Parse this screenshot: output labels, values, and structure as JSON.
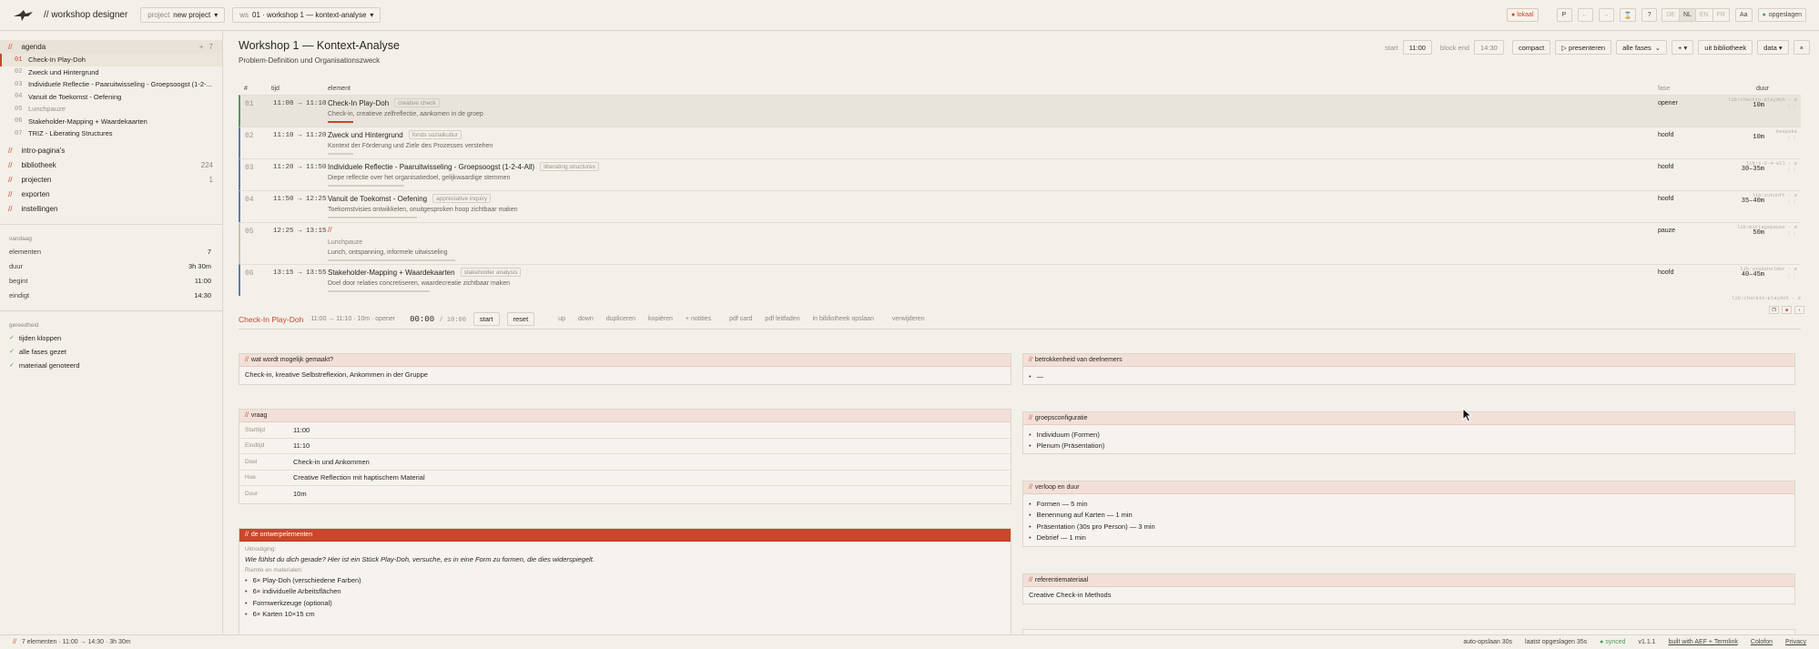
{
  "topbar": {
    "brand": "// workshop designer",
    "project_label": "project",
    "project_value": "new project",
    "ws_label": "ws",
    "ws_value": "01 · workshop 1 — kontext-analyse",
    "local_badge": "lokaal",
    "p_btn": "P",
    "undo": "←",
    "redo": "→",
    "timer_icon": "⌛",
    "help": "?",
    "langs": [
      "DE",
      "NL",
      "EN",
      "FR"
    ],
    "font_btn": "Aa",
    "saved": "opgeslagen"
  },
  "sidebar": {
    "agenda_label": "agenda",
    "agenda_count": "7",
    "items": [
      {
        "n": "01",
        "label": "Check-In Play-Doh"
      },
      {
        "n": "02",
        "label": "Zweck und Hintergrund"
      },
      {
        "n": "03",
        "label": "Individuele Reflectie - Paaruitwisseling - Groepsoogst (1-2-..."
      },
      {
        "n": "04",
        "label": "Vanuit de Toekomst - Oefening"
      },
      {
        "n": "05",
        "label": "Lunchpauze"
      },
      {
        "n": "06",
        "label": "Stakeholder-Mapping + Waardekaarten"
      },
      {
        "n": "07",
        "label": "TRIZ - Liberating Structures"
      }
    ],
    "sections": [
      {
        "label": "intro-pagina's",
        "count": ""
      },
      {
        "label": "bibliotheek",
        "count": "224"
      },
      {
        "label": "projecten",
        "count": "1"
      },
      {
        "label": "exporten",
        "count": ""
      },
      {
        "label": "instellingen",
        "count": ""
      }
    ],
    "today_label": "vandaag",
    "stats": [
      {
        "k": "elementen",
        "v": "7"
      },
      {
        "k": "duur",
        "v": "3h 30m"
      },
      {
        "k": "begint",
        "v": "11:00"
      },
      {
        "k": "eindigt",
        "v": "14:30"
      }
    ],
    "ready_label": "gereedheid",
    "checks": [
      "tijden kloppen",
      "alle fases gezet",
      "materiaal genoteerd"
    ]
  },
  "header": {
    "title": "Workshop 1 — Kontext-Analyse",
    "subtitle": "Problem-Definition und Organisationszweck",
    "start_label": "start",
    "start_value": "11:00",
    "end_label": "block end",
    "end_value": "14:30",
    "compact": "compact",
    "present": "▷ presenteren",
    "phases": "alle fases",
    "add": "+ ▾",
    "library": "uit bibliotheek",
    "data": "data ▾",
    "close": "×"
  },
  "columns": {
    "num": "#",
    "time": "tijd",
    "element": "element",
    "fase": "fase",
    "duur": "duur"
  },
  "rows": [
    {
      "n": "01",
      "time": "11:00 → 11:10",
      "title": "Check-In Play-Doh",
      "tag": "creative check",
      "desc": "Check-in, creatieve zelfreflectie, aankomen in de groep",
      "fase": "opener",
      "dur": "10m",
      "ref": "lib:checkin-playdoh · ⇵"
    },
    {
      "n": "02",
      "time": "11:10 → 11:20",
      "title": "Zweck und Hintergrund",
      "tag": "fonds sozialkultur",
      "desc": "Kontext der Förderung und Ziele des Prozesses verstehen",
      "fase": "hoofd",
      "dur": "10m",
      "ref": "bespoke"
    },
    {
      "n": "03",
      "time": "11:20 → 11:50",
      "title": "Individuele Reflectie - Paaruitwisseling - Groepsoogst (1-2-4-All)",
      "tag": "liberating structures",
      "desc": "Diepe reflectie over het organisatiedoel, gelijkwaardige stemmen",
      "fase": "hoofd",
      "dur": "30–35m",
      "ref": "lib:1-2-4-all · ⇵"
    },
    {
      "n": "04",
      "time": "11:50 → 12:25",
      "title": "Vanuit de Toekomst - Oefening",
      "tag": "appreciative inquiry",
      "desc": "Toekomstvisies ontwikkelen, onuitgesproken hoop zichtbaar maken",
      "fase": "hoofd",
      "dur": "35–40m",
      "ref": "lib:zukunft · ⇵"
    },
    {
      "n": "05",
      "time": "12:25 → 13:15",
      "title": "//",
      "tag": "",
      "desc": "Lunchpauze",
      "desc2": "Lunch, ontspanning, informele uitwisseling",
      "fase": "pauze",
      "dur": "50m",
      "ref": "lib:mittagspause · ⇵"
    },
    {
      "n": "06",
      "time": "13:15 → 13:55",
      "title": "Stakeholder-Mapping + Waardekaarten",
      "tag": "stakeholder analysis",
      "desc": "Doel door relaties concretiseren, waardecreatie zichtbaar maken",
      "fase": "hoofd",
      "dur": "40–45m",
      "ref": "lib:stakeholder · ⇵"
    }
  ],
  "refline": "lib:checkin-playdoh · ⇵",
  "detail": {
    "title": "Check-In Play-Doh",
    "meta": "11:00 → 11:10 · 10m · opener",
    "clock": "00:00",
    "clock_total": "/ 10:00",
    "start": "start",
    "reset": "reset",
    "actions": [
      "up",
      "down",
      "dupliceren",
      "kopiëren",
      "+ notities",
      "pdf card",
      "pdf leitfaden",
      "in bibliotheek opslaan",
      "verwijderen"
    ]
  },
  "cards": {
    "mogelijk": {
      "title": "wat wordt mogelijk gemaakt?",
      "body": "Check-in, kreative Selbstreflexion, Ankommen in der Gruppe"
    },
    "vraag": {
      "title": "vraag",
      "rows": [
        {
          "k": "Starttijd",
          "v": "11:00"
        },
        {
          "k": "Eindtijd",
          "v": "11:10"
        },
        {
          "k": "Doel",
          "v": "Check-in und Ankommen"
        },
        {
          "k": "Hoe",
          "v": "Creative Reflection mit haptischem Material"
        },
        {
          "k": "Duur",
          "v": "10m"
        }
      ]
    },
    "ontwerp": {
      "title": "de ontwerpelementen",
      "uit_label": "Uitnodiging:",
      "question": "Wie fühlst du dich gerade? Hier ist ein Stück Play-Doh, versuche, es in eine Form zu formen, die dies widerspiegelt.",
      "mat_label": "Ruimte en materialen:",
      "items": [
        "6× Play-Doh (verschiedene Farben)",
        "6× individuelle Arbeitsflächen",
        "Formwerkzeuge (optional)",
        "6× Karten 10×15 cm"
      ]
    },
    "betrokken": {
      "title": "betrokkenheid van deelnemers",
      "items": [
        "—"
      ]
    },
    "groeps": {
      "title": "groepsconfiguratie",
      "items": [
        "Individuum (Formen)",
        "Plenum (Präsentation)"
      ]
    },
    "verloop": {
      "title": "verloop en duur",
      "items": [
        "Formen — 5 min",
        "Benennung auf Karten — 1 min",
        "Präsentation (30s pro Person) — 3 min",
        "Debrief — 1 min"
      ]
    },
    "referentie": {
      "title": "referentiemateriaal",
      "body": "Creative Check-in Methods"
    }
  },
  "status": {
    "left": "7 elementen · 11:00 → 14:30 · 3h 30m",
    "autosave": "auto-opslaan 30s",
    "last": "laatst opgeslagen 35s",
    "synced": "● synced",
    "version": "v1.1.1",
    "built": "built with AEF + Termlink",
    "colofon": "Colofon",
    "privacy": "Privacy"
  },
  "colors": {
    "accent": "#c9472a",
    "bg": "#f3f0ea",
    "blue": "#5a79b8",
    "green": "#4d9b5a"
  }
}
